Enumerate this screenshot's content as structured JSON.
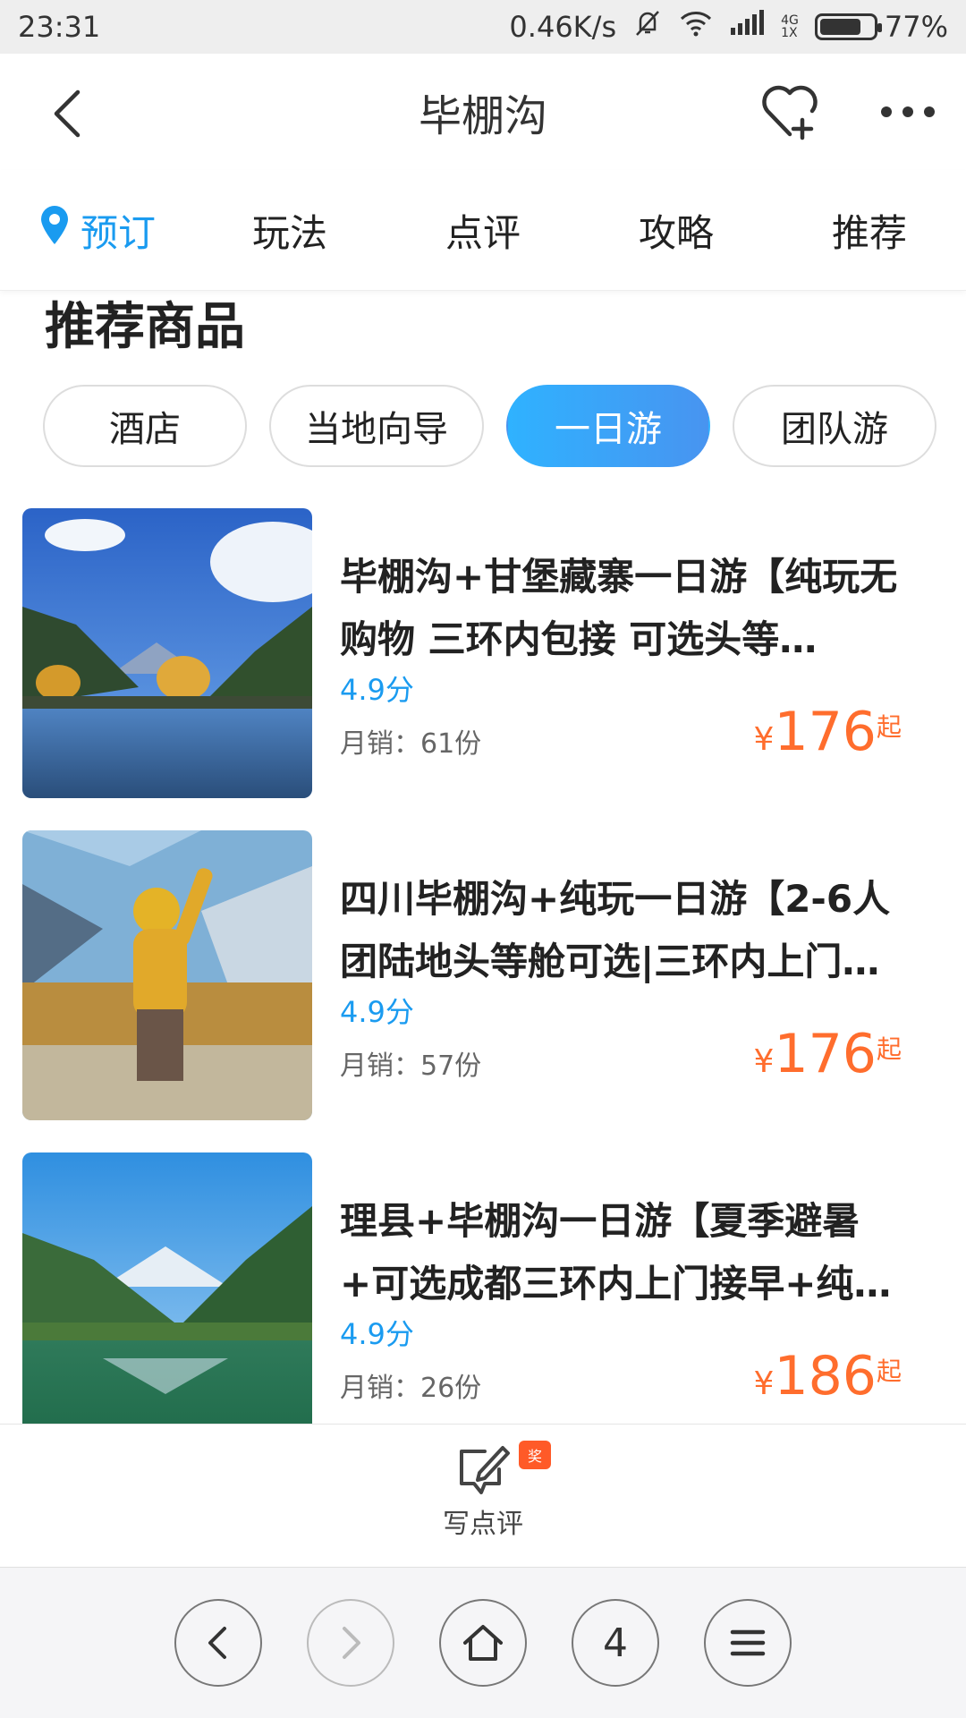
{
  "status_bar": {
    "time": "23:31",
    "net_speed": "0.46K/s",
    "signal_top": "4G",
    "signal_bottom": "1X",
    "battery": "77%"
  },
  "header": {
    "title": "毕棚沟"
  },
  "tabs": [
    {
      "label": "预订",
      "active": true
    },
    {
      "label": "玩法"
    },
    {
      "label": "点评"
    },
    {
      "label": "攻略"
    },
    {
      "label": "推荐"
    }
  ],
  "section": {
    "title": "推荐商品"
  },
  "filters": [
    {
      "label": "酒店"
    },
    {
      "label": "当地向导"
    },
    {
      "label": "一日游",
      "active": true
    },
    {
      "label": "团队游"
    }
  ],
  "products": [
    {
      "title": "毕棚沟+甘堡藏寨一日游【纯玩无购物 三环内包接 可选头等…",
      "score": "4.9分",
      "sales": "月销：61份",
      "currency": "¥",
      "price": "176",
      "suffix": "起"
    },
    {
      "title": "四川毕棚沟+纯玩一日游【2-6人团陆地头等舱可选|三环内上门…",
      "score": "4.9分",
      "sales": "月销：57份",
      "currency": "¥",
      "price": "176",
      "suffix": "起"
    },
    {
      "title": "理县+毕棚沟一日游【夏季避暑+可选成都三环内上门接早+纯…",
      "score": "4.9分",
      "sales": "月销：26份",
      "currency": "¥",
      "price": "186",
      "suffix": "起"
    }
  ],
  "review_bar": {
    "label": "写点评",
    "badge": "奖"
  },
  "browser": {
    "tab_count": "4"
  },
  "colors": {
    "accent": "#1a9bf0",
    "price": "#ff6d2d"
  }
}
